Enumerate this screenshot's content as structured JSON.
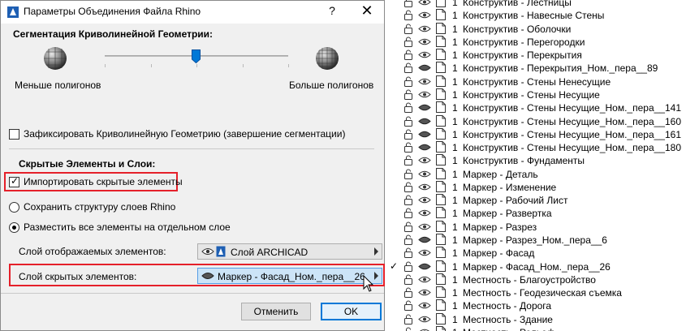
{
  "dialog": {
    "title": "Параметры Объединения Файла Rhino",
    "help_label": "?",
    "close_label": "✕",
    "segmentation": {
      "title": "Сегментация Криволинейной Геометрии:",
      "less_label": "Меньше полигонов",
      "more_label": "Больше полигонов",
      "slider_level": 0.5
    },
    "lock_geometry": {
      "label": "Зафиксировать Криволинейную Геометрию (завершение сегментации)",
      "checked": false
    },
    "hidden_section": {
      "title": "Скрытые Элементы и Слои:",
      "import_hidden": {
        "label": "Импортировать скрытые элементы",
        "checked": true
      },
      "radio_keep": {
        "label": "Сохранить структуру слоев Rhino",
        "selected": false
      },
      "radio_place": {
        "label": "Разместить все элементы на отдельном слое",
        "selected": true
      },
      "visible_layer": {
        "label": "Слой отображаемых элементов:",
        "value": "Слой ARCHICAD"
      },
      "hidden_layer": {
        "label": "Слой скрытых элементов:",
        "value": "Маркер - Фасад_Ном._пера__26"
      }
    },
    "buttons": {
      "cancel": "Отменить",
      "ok": "OK"
    }
  },
  "layers": {
    "rows": [
      {
        "pen": "1",
        "name": "Конструктив - Лестницы",
        "eye": "open",
        "checked": false
      },
      {
        "pen": "1",
        "name": "Конструктив - Навесные Стены",
        "eye": "open",
        "checked": false
      },
      {
        "pen": "1",
        "name": "Конструктив - Оболочки",
        "eye": "open",
        "checked": false
      },
      {
        "pen": "1",
        "name": "Конструктив - Перегородки",
        "eye": "open",
        "checked": false
      },
      {
        "pen": "1",
        "name": "Конструктив - Перекрытия",
        "eye": "open",
        "checked": false
      },
      {
        "pen": "1",
        "name": "Конструктив - Перекрытия_Ном._пера__89",
        "eye": "closed",
        "checked": false
      },
      {
        "pen": "1",
        "name": "Конструктив - Стены Ненесущие",
        "eye": "open",
        "checked": false
      },
      {
        "pen": "1",
        "name": "Конструктив - Стены Несущие",
        "eye": "open",
        "checked": false
      },
      {
        "pen": "1",
        "name": "Конструктив - Стены Несущие_Ном._пера__141",
        "eye": "closed",
        "checked": false
      },
      {
        "pen": "1",
        "name": "Конструктив - Стены Несущие_Ном._пера__160",
        "eye": "closed",
        "checked": false
      },
      {
        "pen": "1",
        "name": "Конструктив - Стены Несущие_Ном._пера__161",
        "eye": "closed",
        "checked": false
      },
      {
        "pen": "1",
        "name": "Конструктив - Стены Несущие_Ном._пера__180",
        "eye": "closed",
        "checked": false
      },
      {
        "pen": "1",
        "name": "Конструктив - Фундаменты",
        "eye": "open",
        "checked": false
      },
      {
        "pen": "1",
        "name": "Маркер - Деталь",
        "eye": "open",
        "checked": false
      },
      {
        "pen": "1",
        "name": "Маркер - Изменение",
        "eye": "open",
        "checked": false
      },
      {
        "pen": "1",
        "name": "Маркер - Рабочий Лист",
        "eye": "open",
        "checked": false
      },
      {
        "pen": "1",
        "name": "Маркер - Развертка",
        "eye": "open",
        "checked": false
      },
      {
        "pen": "1",
        "name": "Маркер - Разрез",
        "eye": "open",
        "checked": false
      },
      {
        "pen": "1",
        "name": "Маркер - Разрез_Ном._пера__6",
        "eye": "closed",
        "checked": false
      },
      {
        "pen": "1",
        "name": "Маркер - Фасад",
        "eye": "open",
        "checked": false
      },
      {
        "pen": "1",
        "name": "Маркер - Фасад_Ном._пера__26",
        "eye": "closed",
        "checked": true
      },
      {
        "pen": "1",
        "name": "Местность - Благоустройство",
        "eye": "open",
        "checked": false
      },
      {
        "pen": "1",
        "name": "Местность - Геодезическая съемка",
        "eye": "open",
        "checked": false
      },
      {
        "pen": "1",
        "name": "Местность - Дорога",
        "eye": "open",
        "checked": false
      },
      {
        "pen": "1",
        "name": "Местность - Здание",
        "eye": "open",
        "checked": false
      },
      {
        "pen": "1",
        "name": "Местность - Рельеф",
        "eye": "open",
        "checked": false
      }
    ]
  },
  "colors": {
    "highlight": "#e5202a",
    "ok_border": "#0078d7",
    "selected_dropdown": "#cce4f7"
  }
}
